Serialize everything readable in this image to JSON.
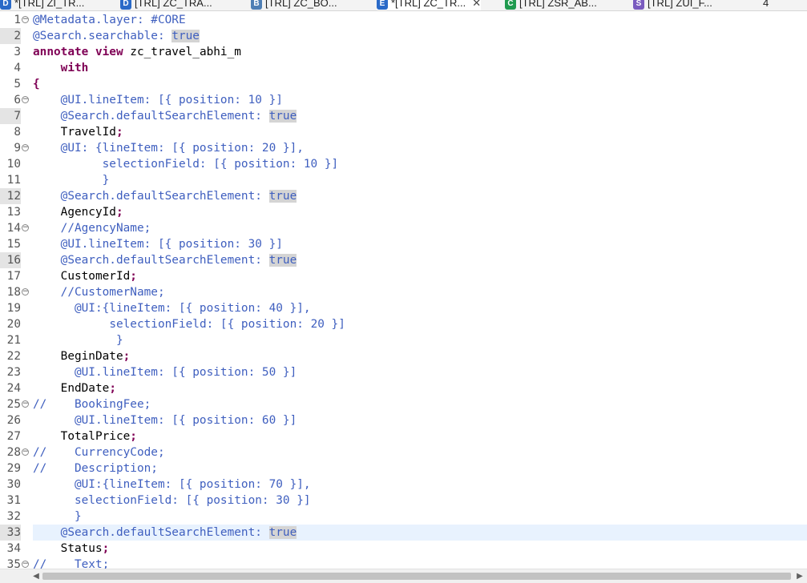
{
  "tabs": [
    {
      "icon": "ddl-icon",
      "icon_color": "#2a6ac8",
      "icon_letter": "D",
      "label": "*[TRL] ZI_TR...",
      "active": false
    },
    {
      "icon": "ddl-icon",
      "icon_color": "#2a6ac8",
      "icon_letter": "D",
      "label": "[TRL] ZC_TRA...",
      "active": false
    },
    {
      "icon": "behavior-icon",
      "icon_color": "#4f7fb5",
      "icon_letter": "B",
      "label": "[TRL] ZC_BO...",
      "active": false
    },
    {
      "icon": "metadata-ext-icon",
      "icon_color": "#2a6ac8",
      "icon_letter": "E",
      "label": "*[TRL] ZC_TR...",
      "active": true,
      "close": "✕"
    },
    {
      "icon": "class-icon",
      "icon_color": "#1f9a4e",
      "icon_letter": "C",
      "label": "[TRL] ZSR_AB...",
      "active": false
    },
    {
      "icon": "service-icon",
      "icon_color": "#7a5bbf",
      "icon_letter": "S",
      "label": "[TRL] ZUI_F...",
      "active": false
    },
    {
      "icon": "overflow-icon",
      "icon_color": "",
      "icon_letter": "",
      "label": "4",
      "active": false
    }
  ],
  "editor": {
    "current_line": 33,
    "lines": [
      {
        "n": "1",
        "fold": true,
        "mark": false,
        "tokens": [
          [
            "ann",
            "@Metadata.layer: #CORE"
          ]
        ]
      },
      {
        "n": "2",
        "fold": false,
        "mark": true,
        "tokens": [
          [
            "ann",
            "@Search.searchable: "
          ],
          [
            "hl",
            "true"
          ]
        ]
      },
      {
        "n": "3",
        "fold": false,
        "mark": false,
        "tokens": [
          [
            "kw",
            "annotate"
          ],
          [
            "plain",
            " "
          ],
          [
            "kw",
            "view"
          ],
          [
            "plain",
            " zc_travel_abhi_m"
          ]
        ]
      },
      {
        "n": "4",
        "fold": false,
        "mark": false,
        "tokens": [
          [
            "plain",
            "    "
          ],
          [
            "kw",
            "with"
          ]
        ]
      },
      {
        "n": "5",
        "fold": false,
        "mark": false,
        "tokens": [
          [
            "punc",
            "{"
          ]
        ]
      },
      {
        "n": "6",
        "fold": true,
        "mark": false,
        "tokens": [
          [
            "plain",
            "    "
          ],
          [
            "ann",
            "@UI.lineItem: [{ position: 10 }]"
          ]
        ]
      },
      {
        "n": "7",
        "fold": false,
        "mark": true,
        "tokens": [
          [
            "plain",
            "    "
          ],
          [
            "ann",
            "@Search.defaultSearchElement: "
          ],
          [
            "hl",
            "true"
          ]
        ]
      },
      {
        "n": "8",
        "fold": false,
        "mark": false,
        "tokens": [
          [
            "plain",
            "    TravelId"
          ],
          [
            "punc",
            ";"
          ]
        ]
      },
      {
        "n": "9",
        "fold": true,
        "mark": false,
        "tokens": [
          [
            "plain",
            "    "
          ],
          [
            "ann",
            "@UI: {lineItem: [{ position: 20 }],"
          ]
        ]
      },
      {
        "n": "10",
        "fold": false,
        "mark": false,
        "tokens": [
          [
            "plain",
            "          "
          ],
          [
            "ann",
            "selectionField: [{ position: 10 }]"
          ]
        ]
      },
      {
        "n": "11",
        "fold": false,
        "mark": false,
        "tokens": [
          [
            "plain",
            "          "
          ],
          [
            "ann",
            "}"
          ]
        ]
      },
      {
        "n": "12",
        "fold": false,
        "mark": true,
        "tokens": [
          [
            "plain",
            "    "
          ],
          [
            "ann",
            "@Search.defaultSearchElement: "
          ],
          [
            "hl",
            "true"
          ]
        ]
      },
      {
        "n": "13",
        "fold": false,
        "mark": false,
        "tokens": [
          [
            "plain",
            "    AgencyId"
          ],
          [
            "punc",
            ";"
          ]
        ]
      },
      {
        "n": "14",
        "fold": true,
        "mark": false,
        "tokens": [
          [
            "plain",
            "    "
          ],
          [
            "comment",
            "//AgencyName;"
          ]
        ]
      },
      {
        "n": "15",
        "fold": false,
        "mark": false,
        "tokens": [
          [
            "plain",
            "    "
          ],
          [
            "ann",
            "@UI.lineItem: [{ position: 30 }]"
          ]
        ]
      },
      {
        "n": "16",
        "fold": false,
        "mark": true,
        "tokens": [
          [
            "plain",
            "    "
          ],
          [
            "ann",
            "@Search.defaultSearchElement: "
          ],
          [
            "hl",
            "true"
          ]
        ]
      },
      {
        "n": "17",
        "fold": false,
        "mark": false,
        "tokens": [
          [
            "plain",
            "    CustomerId"
          ],
          [
            "punc",
            ";"
          ]
        ]
      },
      {
        "n": "18",
        "fold": true,
        "mark": false,
        "tokens": [
          [
            "plain",
            "    "
          ],
          [
            "comment",
            "//CustomerName;"
          ]
        ]
      },
      {
        "n": "19",
        "fold": false,
        "mark": false,
        "tokens": [
          [
            "plain",
            "      "
          ],
          [
            "ann",
            "@UI:{lineItem: [{ position: 40 }],"
          ]
        ]
      },
      {
        "n": "20",
        "fold": false,
        "mark": false,
        "tokens": [
          [
            "plain",
            "           "
          ],
          [
            "ann",
            "selectionField: [{ position: 20 }]"
          ]
        ]
      },
      {
        "n": "21",
        "fold": false,
        "mark": false,
        "tokens": [
          [
            "plain",
            "            "
          ],
          [
            "ann",
            "}"
          ]
        ]
      },
      {
        "n": "22",
        "fold": false,
        "mark": false,
        "tokens": [
          [
            "plain",
            "    BeginDate"
          ],
          [
            "punc",
            ";"
          ]
        ]
      },
      {
        "n": "23",
        "fold": false,
        "mark": false,
        "tokens": [
          [
            "plain",
            "      "
          ],
          [
            "ann",
            "@UI.lineItem: [{ position: 50 }]"
          ]
        ]
      },
      {
        "n": "24",
        "fold": false,
        "mark": false,
        "tokens": [
          [
            "plain",
            "    EndDate"
          ],
          [
            "punc",
            ";"
          ]
        ]
      },
      {
        "n": "25",
        "fold": true,
        "mark": false,
        "tokens": [
          [
            "comment",
            "//    BookingFee;"
          ]
        ]
      },
      {
        "n": "26",
        "fold": false,
        "mark": false,
        "tokens": [
          [
            "plain",
            "      "
          ],
          [
            "ann",
            "@UI.lineItem: [{ position: 60 }]"
          ]
        ]
      },
      {
        "n": "27",
        "fold": false,
        "mark": false,
        "tokens": [
          [
            "plain",
            "    TotalPrice"
          ],
          [
            "punc",
            ";"
          ]
        ]
      },
      {
        "n": "28",
        "fold": true,
        "mark": false,
        "tokens": [
          [
            "comment",
            "//    CurrencyCode;"
          ]
        ]
      },
      {
        "n": "29",
        "fold": false,
        "mark": false,
        "tokens": [
          [
            "comment",
            "//    Description;"
          ]
        ]
      },
      {
        "n": "30",
        "fold": false,
        "mark": false,
        "tokens": [
          [
            "plain",
            "      "
          ],
          [
            "ann",
            "@UI:{lineItem: [{ position: 70 }],"
          ]
        ]
      },
      {
        "n": "31",
        "fold": false,
        "mark": false,
        "tokens": [
          [
            "plain",
            "      "
          ],
          [
            "ann",
            "selectionField: [{ position: 30 }]"
          ]
        ]
      },
      {
        "n": "32",
        "fold": false,
        "mark": false,
        "tokens": [
          [
            "plain",
            "      "
          ],
          [
            "ann",
            "}"
          ]
        ]
      },
      {
        "n": "33",
        "fold": false,
        "mark": true,
        "tokens": [
          [
            "plain",
            "    "
          ],
          [
            "ann",
            "@Search.defaultSearchElement: "
          ],
          [
            "hl",
            "true"
          ]
        ]
      },
      {
        "n": "34",
        "fold": false,
        "mark": false,
        "tokens": [
          [
            "plain",
            "    Status"
          ],
          [
            "punc",
            ";"
          ]
        ]
      },
      {
        "n": "35",
        "fold": true,
        "mark": false,
        "tokens": [
          [
            "comment",
            "//    Text;"
          ]
        ]
      }
    ]
  },
  "scrollbar": {
    "left_arrow": "◀",
    "right_arrow": "▶"
  }
}
